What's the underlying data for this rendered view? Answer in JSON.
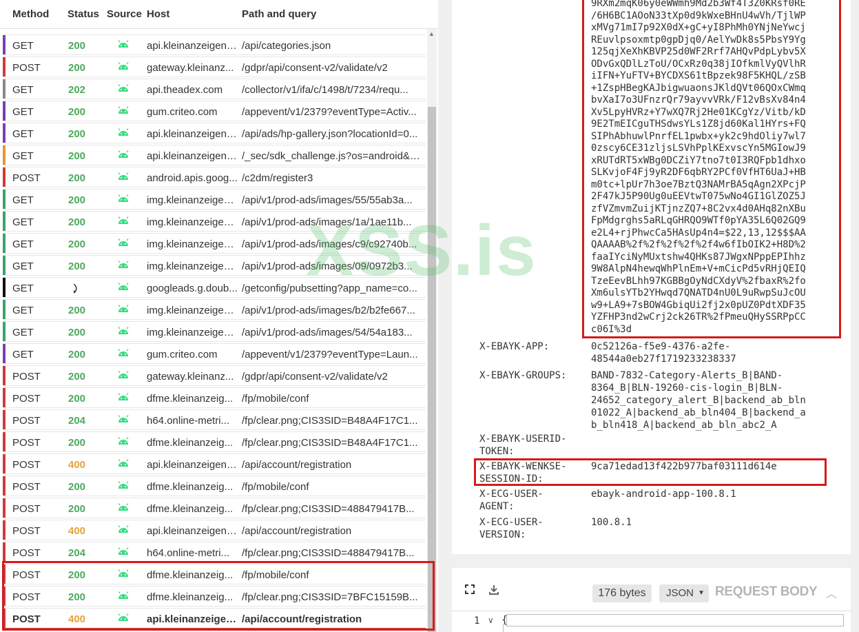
{
  "table": {
    "columns": [
      "Method",
      "Status",
      "Source",
      "Host",
      "Path and query"
    ],
    "rows": [
      {
        "method": "GET",
        "status": "200",
        "source": "android-icon",
        "host": "api.kleinanzeigen....",
        "path": "/api/categories.json",
        "bar": "#7b3fb0"
      },
      {
        "method": "POST",
        "status": "200",
        "source": "android-icon",
        "host": "gateway.kleinanz...",
        "path": "/gdpr/api/consent-v2/validate/v2",
        "bar": "#d13b3b"
      },
      {
        "method": "GET",
        "status": "202",
        "source": "android-icon",
        "host": "api.theadex.com",
        "path": "/collector/v1/ifa/c/1498/t/7234/requ...",
        "bar": "#8a8a8a"
      },
      {
        "method": "GET",
        "status": "200",
        "source": "android-icon",
        "host": "gum.criteo.com",
        "path": "/appevent/v1/2379?eventType=Activ...",
        "bar": "#7b3fb0"
      },
      {
        "method": "GET",
        "status": "200",
        "source": "android-icon",
        "host": "api.kleinanzeigen....",
        "path": "/api/ads/hp-gallery.json?locationId=0...",
        "bar": "#7b3fb0"
      },
      {
        "method": "GET",
        "status": "200",
        "source": "android-icon",
        "host": "api.kleinanzeigen....",
        "path": "/_sec/sdk_challenge.js?os=android&st...",
        "bar": "#e8952f"
      },
      {
        "method": "POST",
        "status": "200",
        "source": "android-icon",
        "host": "android.apis.goog...",
        "path": "/c2dm/register3",
        "bar": "#d13b3b"
      },
      {
        "method": "GET",
        "status": "200",
        "source": "android-icon",
        "host": "img.kleinanzeigen...",
        "path": "/api/v1/prod-ads/images/55/55ab3a...",
        "bar": "#3aa56a"
      },
      {
        "method": "GET",
        "status": "200",
        "source": "android-icon",
        "host": "img.kleinanzeigen...",
        "path": "/api/v1/prod-ads/images/1a/1ae11b...",
        "bar": "#3aa56a"
      },
      {
        "method": "GET",
        "status": "200",
        "source": "android-icon",
        "host": "img.kleinanzeigen...",
        "path": "/api/v1/prod-ads/images/c9/c92740b...",
        "bar": "#3aa56a"
      },
      {
        "method": "GET",
        "status": "200",
        "source": "android-icon",
        "host": "img.kleinanzeigen...",
        "path": "/api/v1/prod-ads/images/09/0972b3...",
        "bar": "#3aa56a"
      },
      {
        "method": "GET",
        "status": "⃠",
        "source": "android-icon",
        "host": "googleads.g.doub...",
        "path": "/getconfig/pubsetting?app_name=co...",
        "bar": "#111111"
      },
      {
        "method": "GET",
        "status": "200",
        "source": "android-icon",
        "host": "img.kleinanzeigen...",
        "path": "/api/v1/prod-ads/images/b2/b2fe667...",
        "bar": "#3aa56a"
      },
      {
        "method": "GET",
        "status": "200",
        "source": "android-icon",
        "host": "img.kleinanzeigen...",
        "path": "/api/v1/prod-ads/images/54/54a183...",
        "bar": "#3aa56a"
      },
      {
        "method": "GET",
        "status": "200",
        "source": "android-icon",
        "host": "gum.criteo.com",
        "path": "/appevent/v1/2379?eventType=Laun...",
        "bar": "#7b3fb0"
      },
      {
        "method": "POST",
        "status": "200",
        "source": "android-icon",
        "host": "gateway.kleinanz...",
        "path": "/gdpr/api/consent-v2/validate/v2",
        "bar": "#d13b3b"
      },
      {
        "method": "POST",
        "status": "200",
        "source": "android-icon",
        "host": "dfme.kleinanzeig...",
        "path": "/fp/mobile/conf",
        "bar": "#d13b3b"
      },
      {
        "method": "POST",
        "status": "204",
        "source": "android-icon",
        "host": "h64.online-metri...",
        "path": "/fp/clear.png;CIS3SID=B48A4F17C1...",
        "bar": "#d13b3b"
      },
      {
        "method": "POST",
        "status": "200",
        "source": "android-icon",
        "host": "dfme.kleinanzeig...",
        "path": "/fp/clear.png;CIS3SID=B48A4F17C1...",
        "bar": "#d13b3b"
      },
      {
        "method": "POST",
        "status": "400",
        "source": "android-icon",
        "host": "api.kleinanzeigen....",
        "path": "/api/account/registration",
        "bar": "#d13b3b"
      },
      {
        "method": "POST",
        "status": "200",
        "source": "android-icon",
        "host": "dfme.kleinanzeig...",
        "path": "/fp/mobile/conf",
        "bar": "#d13b3b"
      },
      {
        "method": "POST",
        "status": "200",
        "source": "android-icon",
        "host": "dfme.kleinanzeig...",
        "path": "/fp/clear.png;CIS3SID=488479417B...",
        "bar": "#d13b3b"
      },
      {
        "method": "POST",
        "status": "400",
        "source": "android-icon",
        "host": "api.kleinanzeigen....",
        "path": "/api/account/registration",
        "bar": "#d13b3b"
      },
      {
        "method": "POST",
        "status": "204",
        "source": "android-icon",
        "host": "h64.online-metri...",
        "path": "/fp/clear.png;CIS3SID=488479417B...",
        "bar": "#d13b3b"
      },
      {
        "method": "POST",
        "status": "200",
        "source": "android-icon",
        "host": "dfme.kleinanzeig...",
        "path": "/fp/mobile/conf",
        "bar": "#d13b3b"
      },
      {
        "method": "POST",
        "status": "200",
        "source": "android-icon",
        "host": "dfme.kleinanzeig...",
        "path": "/fp/clear.png;CIS3SID=7BFC15159B...",
        "bar": "#d13b3b"
      },
      {
        "method": "POST",
        "status": "400",
        "source": "android-icon",
        "host": "api.kleinanzeigen....",
        "path": "/api/account/registration",
        "bar": "#d13b3b",
        "selected": true
      }
    ]
  },
  "headers": {
    "blob_lines": [
      "9RXm2mqK06y0eWWmh9Md2b3Wf4T3Z0KRsf0RE",
      "/6H6BC1AOoN33tXp0d9kWxeBHnU4wVh/TjlWP",
      "xMVg71mI7p92X0dX+gC+yI8PhMh0YNjNeYwcj",
      "REuvlpsoxmtp0gpDjq0/AelYwDk8s5PbsY9Yg",
      "125qjXeXhKBVP25d0WF2Rrf7AHQvPdpLybv5X",
      "ODvGxQDlLzToU/OCxRz0q38jIOfkmlVyQVlhR",
      "iIFN+YuFTV+BYCDXS61tBpzek98F5KHQL/zSB",
      "+1ZspHBegKAJbigwuaonsJKldQVt06QOxCWmq",
      "bvXaI7o3UFnzrQr79ayvvVRk/F12vBsXv84n4",
      "Xv5LpyHVRz+Y7wXQ7Rj2He01KCgYz/Vitb/kD",
      "9E2TmEICguTHSdwsYLs1Z8jd60Kal1HYrs+FQ",
      "SIPhAbhuwlPnrfEL1pwbx+yk2c9hdOliy7wl7",
      "0zscy6CE31zljsLSVhPplKExvscYn5MGIowJ9",
      "xRUTdRT5xWBg0DCZiY7tno7t0I3RQFpb1dhxo",
      "SLKvjoF4Fj9yR2DF6qbRY2PCf0VfHT6UaJ+HB",
      "m0tc+lpUr7h3oe7BztQ3NAMrBA5qAgn2XPcjP",
      "2F47kJ5P90Ug0uEEVtwT075wNo4GI1GlZOZ5J",
      "zfVZmvmZuijKTjnzZQ7+8C2vx4d0AHq82nXBu",
      "FpMdgrghs5aRLqGHRQO9WTf0pYA35L6Q02GQ9",
      "e2L4+rjPhwcCa5HAsUp4n4=$22,13,12$$$AA",
      "QAAAAB%2f%2f%2f%2f%2f4w6fIbOIK2+H8D%2",
      "faaIYciNyMUxtshw4QHKs87JWgxNPppEPIhhz",
      "9W8AlpN4hewqWhPlnEm+V+mCicPd5vRHjQEIQ",
      "TzeEevBLhh97KGBBgOyNdCXdyV%2fbaxR%2fo",
      "Xm6ulsYTb2YHwqd7QNATD4nU0L9uRwpSuJcOU",
      "w9+LA9+7sBOW4GbiqUi2fj2x0pUZ0PdtXDF35",
      "YZFHP3nd2wCrj2ck26TR%2fPmeuQHySSRPpCC",
      "c06I%3d"
    ],
    "items": [
      {
        "key": "X-EBAYK-APP:",
        "value": "0c52126a-f5e9-4376-a2fe-\n48544a0eb27f1719233238337"
      },
      {
        "key": "X-EBAYK-GROUPS:",
        "value": "BAND-7832-Category-Alerts_B|BAND-\n8364_B|BLN-19260-cis-login_B|BLN-\n24652_category_alert_B|backend_ab_bln\n01022_A|backend_ab_bln404_B|backend_a\nb_bln418_A|backend_ab_bln_abc2_A"
      },
      {
        "key": "X-EBAYK-USERID-\nTOKEN:",
        "value": ""
      },
      {
        "key": "X-EBAYK-WENKSE-\nSESSION-ID:",
        "value": "9ca71edad13f422b977baf03111d614e"
      },
      {
        "key": "X-ECG-USER-\nAGENT:",
        "value": "ebayk-android-app-100.8.1"
      },
      {
        "key": "X-ECG-USER-\nVERSION:",
        "value": "100.8.1"
      }
    ]
  },
  "body": {
    "size": "176 bytes",
    "format": "JSON",
    "title": "REQUEST BODY",
    "line_no": "1",
    "code": "{"
  },
  "watermark": "XSS.is",
  "colors": {
    "ok": "#4caa5a",
    "client_error": "#e4a33a",
    "highlight": "#d7191c"
  }
}
